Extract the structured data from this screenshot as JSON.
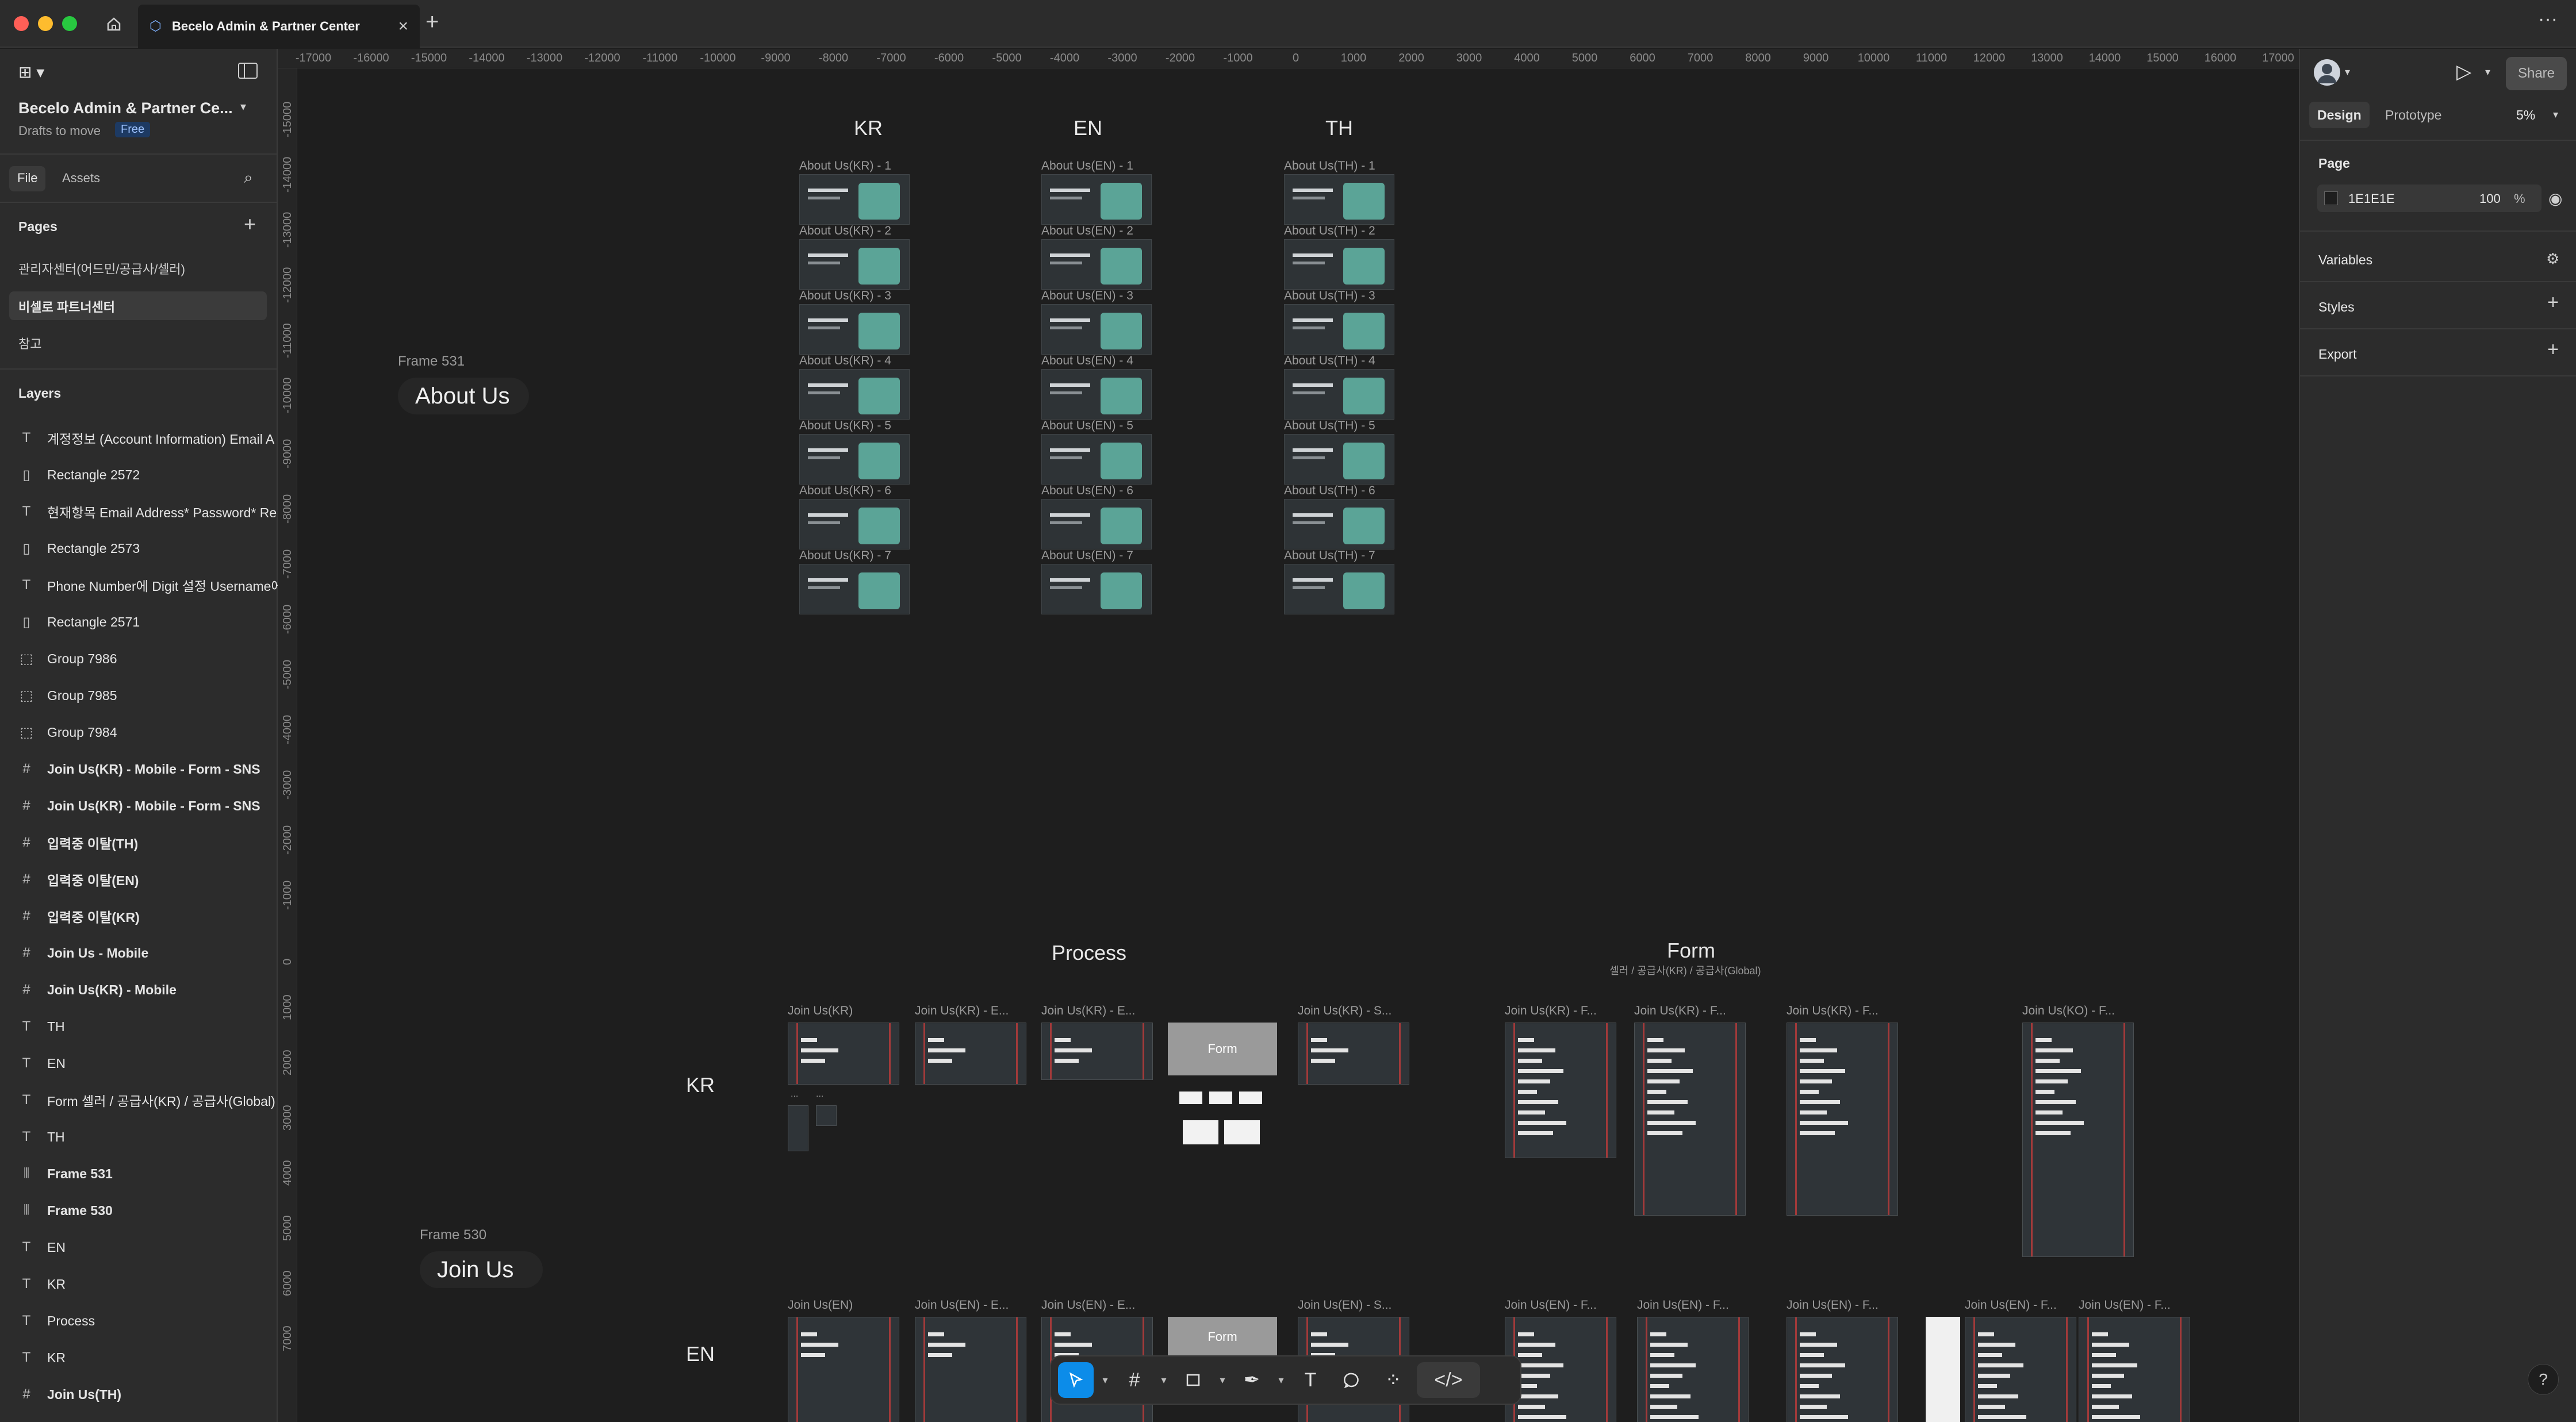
{
  "titlebar": {
    "tab_title": "Becelo Admin & Partner Center",
    "more": "···"
  },
  "left_panel": {
    "project_name": "Becelo Admin & Partner Ce...",
    "drafts_label": "Drafts to move",
    "plan_badge": "Free",
    "tabs": [
      "File",
      "Assets"
    ],
    "pages_header": "Pages",
    "pages": [
      "관리자센터(어드민/공급사/셀러)",
      "비셀로 파트너센터",
      "참고"
    ],
    "layers_header": "Layers",
    "layers": [
      {
        "icon": "text-icon",
        "label": "계정정보 (Account Information) Email A",
        "bold": false
      },
      {
        "icon": "rectangle-icon",
        "label": "Rectangle 2572",
        "bold": false
      },
      {
        "icon": "text-icon",
        "label": "현재항목 Email Address* Password* Re",
        "bold": false
      },
      {
        "icon": "rectangle-icon",
        "label": "Rectangle 2573",
        "bold": false
      },
      {
        "icon": "text-icon",
        "label": "Phone Number에 Digit 설정 Username에",
        "bold": false
      },
      {
        "icon": "rectangle-icon",
        "label": "Rectangle 2571",
        "bold": false
      },
      {
        "icon": "group-icon",
        "label": "Group 7986",
        "bold": false
      },
      {
        "icon": "group-icon",
        "label": "Group 7985",
        "bold": false
      },
      {
        "icon": "group-icon",
        "label": "Group 7984",
        "bold": false
      },
      {
        "icon": "frame-icon",
        "label": "Join Us(KR) - Mobile - Form - SNS",
        "bold": true
      },
      {
        "icon": "frame-icon",
        "label": "Join Us(KR) - Mobile - Form - SNS",
        "bold": true
      },
      {
        "icon": "frame-icon",
        "label": "입력중 이탈(TH)",
        "bold": true
      },
      {
        "icon": "frame-icon",
        "label": "입력중 이탈(EN)",
        "bold": true
      },
      {
        "icon": "frame-icon",
        "label": "입력중 이탈(KR)",
        "bold": true
      },
      {
        "icon": "frame-icon",
        "label": "Join Us - Mobile",
        "bold": true
      },
      {
        "icon": "frame-icon",
        "label": "Join Us(KR) - Mobile",
        "bold": true
      },
      {
        "icon": "text-icon",
        "label": "TH",
        "bold": false
      },
      {
        "icon": "text-icon",
        "label": "EN",
        "bold": false
      },
      {
        "icon": "text-icon",
        "label": "Form 셀러 / 공급사(KR) / 공급사(Global)",
        "bold": false
      },
      {
        "icon": "text-icon",
        "label": "TH",
        "bold": false
      },
      {
        "icon": "autolayout-icon",
        "label": "Frame 531",
        "bold": true
      },
      {
        "icon": "autolayout-icon",
        "label": "Frame 530",
        "bold": true
      },
      {
        "icon": "text-icon",
        "label": "EN",
        "bold": false
      },
      {
        "icon": "text-icon",
        "label": "KR",
        "bold": false
      },
      {
        "icon": "text-icon",
        "label": "Process",
        "bold": false
      },
      {
        "icon": "text-icon",
        "label": "KR",
        "bold": false
      },
      {
        "icon": "frame-icon",
        "label": "Join Us(TH)",
        "bold": true
      }
    ]
  },
  "rulers": {
    "x_ticks": [
      "-17000",
      "-16000",
      "-15000",
      "-14000",
      "-13000",
      "-12000",
      "-11000",
      "-10000",
      "-9000",
      "-8000",
      "-7000",
      "-6000",
      "-5000",
      "-4000",
      "-3000",
      "-2000",
      "-1000",
      "0",
      "1000",
      "2000",
      "3000",
      "4000",
      "5000",
      "6000",
      "7000",
      "8000",
      "9000",
      "10000",
      "11000",
      "12000",
      "13000",
      "14000",
      "15000",
      "16000",
      "17000"
    ],
    "y_ticks": [
      "-15000",
      "-14000",
      "-13000",
      "-12000",
      "-11000",
      "-10000",
      "-9000",
      "-8000",
      "-7000",
      "-6000",
      "-5000",
      "-4000",
      "-3000",
      "-2000",
      "-1000",
      "0",
      "1000",
      "2000",
      "3000",
      "4000",
      "5000",
      "6000",
      "7000"
    ]
  },
  "canvas": {
    "lang_headers": [
      "KR",
      "EN",
      "TH"
    ],
    "frame531_label": "Frame 531",
    "about_us_title": "About Us",
    "about_kr": [
      "About Us(KR) - 1",
      "About Us(KR) - 2",
      "About Us(KR) - 3",
      "About Us(KR) - 4",
      "About Us(KR) - 5",
      "About Us(KR) - 6",
      "About Us(KR) - 7"
    ],
    "about_en": [
      "About Us(EN) - 1",
      "About Us(EN) - 2",
      "About Us(EN) - 3",
      "About Us(EN) - 4",
      "About Us(EN) - 5",
      "About Us(EN) - 6",
      "About Us(EN) - 7"
    ],
    "about_th": [
      "About Us(TH) - 1",
      "About Us(TH) - 2",
      "About Us(TH) - 3",
      "About Us(TH) - 4",
      "About Us(TH) - 5",
      "About Us(TH) - 6",
      "About Us(TH) - 7"
    ],
    "process_title": "Process",
    "form_title": "Form",
    "form_subtitle": "셀러 / 공급사(KR) / 공급사(Global)",
    "row_kr_label": "KR",
    "row_en_label": "EN",
    "frame530_label": "Frame 530",
    "join_us_title": "Join Us",
    "kr_frames": [
      "Join Us(KR)",
      "Join Us(KR) - E...",
      "Join Us(KR) - E...",
      "Join Us(KR) - S...",
      "Join Us(KR) - F...",
      "Join Us(KR) - F...",
      "Join Us(KR) - F...",
      "Join Us(KO) - F..."
    ],
    "en_frames": [
      "Join Us(EN)",
      "Join Us(EN) - E...",
      "Join Us(EN) - E...",
      "Join Us(EN) - S...",
      "Join Us(EN) - F...",
      "Join Us(EN) - F...",
      "Join Us(EN) - F...",
      "Join Us(EN) - F...",
      "Join Us(EN) - F..."
    ],
    "form_box_label": "Form",
    "ellipsis": "..."
  },
  "right_panel": {
    "tabs": [
      "Design",
      "Prototype"
    ],
    "zoom": "5%",
    "share_label": "Share",
    "page_section": "Page",
    "bg_hex": "1E1E1E",
    "bg_color": "#1E1E1E",
    "opacity": "100",
    "opacity_unit": "%",
    "variables_label": "Variables",
    "styles_label": "Styles",
    "export_label": "Export"
  },
  "help_label": "?"
}
